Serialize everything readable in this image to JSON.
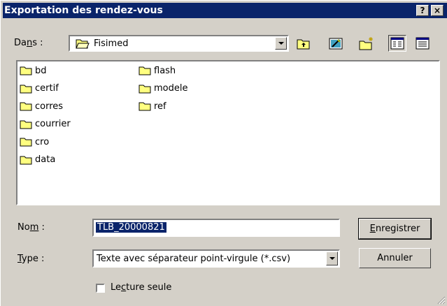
{
  "window": {
    "title": "Exportation des rendez-vous",
    "help_btn": "?",
    "close_btn": "×"
  },
  "location": {
    "label_pre": "Da",
    "label_u": "n",
    "label_post": "s :",
    "value": "Fisimed"
  },
  "toolbar": {
    "icons": [
      "up-folder-icon",
      "desktop-icon",
      "new-folder-icon",
      "list-view-icon",
      "details-view-icon"
    ]
  },
  "files": {
    "col1": [
      "bd",
      "certif",
      "corres",
      "courrier",
      "cro",
      "data"
    ],
    "col2": [
      "flash",
      "modele",
      "ref"
    ]
  },
  "name": {
    "label_pre": "No",
    "label_u": "m",
    "label_post": " :",
    "value": "TLB_20000821"
  },
  "type": {
    "label_u": "T",
    "label_post": "ype :",
    "value": "Texte avec séparateur point-virgule (*.csv)"
  },
  "buttons": {
    "save_u": "E",
    "save_rest": "nregistrer",
    "cancel": "Annuler"
  },
  "readonly": {
    "pre": "Le",
    "u": "c",
    "post": "ture seule"
  }
}
